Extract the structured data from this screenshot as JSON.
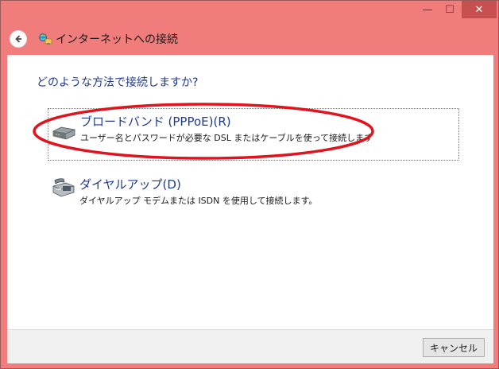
{
  "window": {
    "title": "インターネットへの接続",
    "minimize_glyph": "—",
    "maximize_glyph": "☐",
    "close_glyph": "✕"
  },
  "content": {
    "question": "どのような方法で接続しますか?"
  },
  "options": [
    {
      "title": "ブロードバンド (PPPoE)(R)",
      "description": "ユーザー名とパスワードが必要な DSL またはケーブルを使って接続します",
      "icon": "broadband-modem-icon"
    },
    {
      "title": "ダイヤルアップ(D)",
      "description": "ダイヤルアップ モデムまたは ISDN を使用して接続します。",
      "icon": "dialup-phone-icon"
    }
  ],
  "footer": {
    "cancel_label": "キャンセル"
  },
  "colors": {
    "frame": "#f07c7c",
    "close_button": "#c74f4f",
    "annotation_ellipse": "#e0141e",
    "link_text": "#1e3a8a"
  }
}
